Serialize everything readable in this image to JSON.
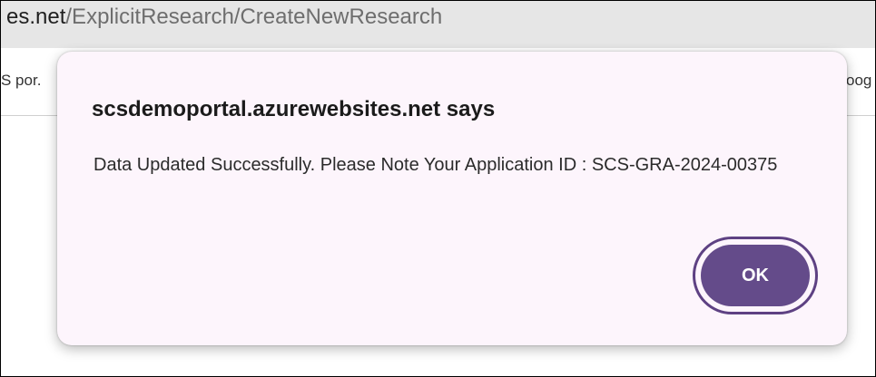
{
  "browser": {
    "url_domain": "es.net",
    "url_path": "/ExplicitResearch/CreateNewResearch",
    "bookmark_left_partial": "S por.",
    "bookmark_right_partial": "oog"
  },
  "dialog": {
    "title": "scsdemoportal.azurewebsites.net says",
    "message": "Data Updated Successfully. Please Note Your Application ID : SCS-GRA-2024-00375",
    "ok_label": "OK"
  },
  "colors": {
    "dialog_background": "#fdf5fc",
    "ok_button": "#644b8a",
    "ok_focus_ring": "#5e4183",
    "address_bar": "#e6e6e6"
  }
}
